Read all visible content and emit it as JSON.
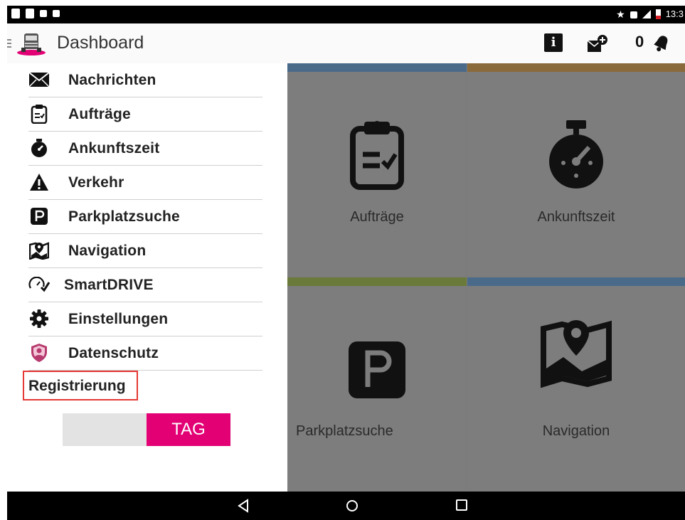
{
  "status_bar": {
    "time": "13:3"
  },
  "action_bar": {
    "title": "Dashboard",
    "info_label": "i",
    "notification_count": "0"
  },
  "drawer": {
    "items": [
      {
        "label": "Nachrichten",
        "icon": "envelope-icon"
      },
      {
        "label": "Aufträge",
        "icon": "clipboard-check-icon"
      },
      {
        "label": "Ankunftszeit",
        "icon": "stopwatch-icon"
      },
      {
        "label": "Verkehr",
        "icon": "warning-icon"
      },
      {
        "label": "Parkplatzsuche",
        "icon": "parking-icon"
      },
      {
        "label": "Navigation",
        "icon": "map-pin-icon"
      },
      {
        "label": "SmartDRIVE",
        "icon": "speedometer-check-icon"
      },
      {
        "label": "Einstellungen",
        "icon": "gear-icon"
      },
      {
        "label": "Datenschutz",
        "icon": "privacy-shield-icon"
      }
    ],
    "registration_label": "Registrierung",
    "mode_toggle": {
      "active_label": "TAG",
      "active_color": "#e20074"
    }
  },
  "dashboard": {
    "tiles": [
      {
        "label": "Aufträge",
        "icon": "clipboard-check-icon",
        "accent": "#4a6a8a"
      },
      {
        "label": "Ankunftszeit",
        "icon": "stopwatch-icon",
        "accent": "#8a6a3a"
      },
      {
        "label": "Parkplatzsuche",
        "icon": "parking-icon",
        "accent": "#6a7a3a"
      },
      {
        "label": "Navigation",
        "icon": "map-pin-icon",
        "accent": "#4a6a8a"
      }
    ]
  },
  "nav_bar": {
    "back": "back-icon",
    "home": "home-icon",
    "recents": "recents-icon"
  }
}
